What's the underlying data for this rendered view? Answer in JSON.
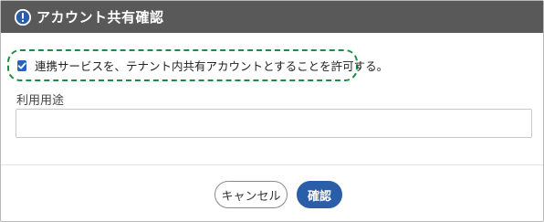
{
  "dialog": {
    "title": "アカウント共有確認",
    "title_icon": "info-icon",
    "consent_checked": true,
    "consent_label": "連携サービスを、テナント内共有アカウントとすることを許可する。",
    "purpose_label": "利用用途",
    "purpose_value": "",
    "cancel_label": "キャンセル",
    "confirm_label": "確認"
  },
  "colors": {
    "titlebar": "#595959",
    "accent": "#2a5ea9",
    "highlight_border": "#1e8c45"
  }
}
